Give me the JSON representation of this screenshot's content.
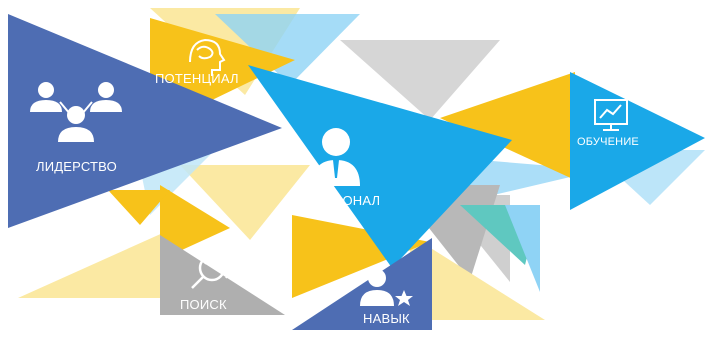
{
  "labels": {
    "leadership": "ЛИДЕРСТВО",
    "potential": "ПОТЕНЦИАЛ",
    "personnel": "ПЕРСОНАЛ",
    "training": "ОБУЧЕНИЕ",
    "search": "ПОИСК",
    "skill": "НАВЫК"
  },
  "icons": {
    "leadership": "team-hierarchy-icon",
    "potential": "head-with-brain-icon",
    "personnel": "person-in-suit-icon",
    "training": "presentation-board-chart-icon",
    "search": "magnifier-refresh-icon",
    "skill": "person-with-star-icon"
  },
  "colors": {
    "royal_blue": "#4E6DB3",
    "sky_blue": "#1AA8E8",
    "light_blue": "#8FD3F5",
    "yellow": "#F7C21A",
    "pale_yellow": "#FBE9A3",
    "gray": "#AFAFAF",
    "light_gray": "#D6D6D6",
    "teal": "#5FC8C0"
  }
}
